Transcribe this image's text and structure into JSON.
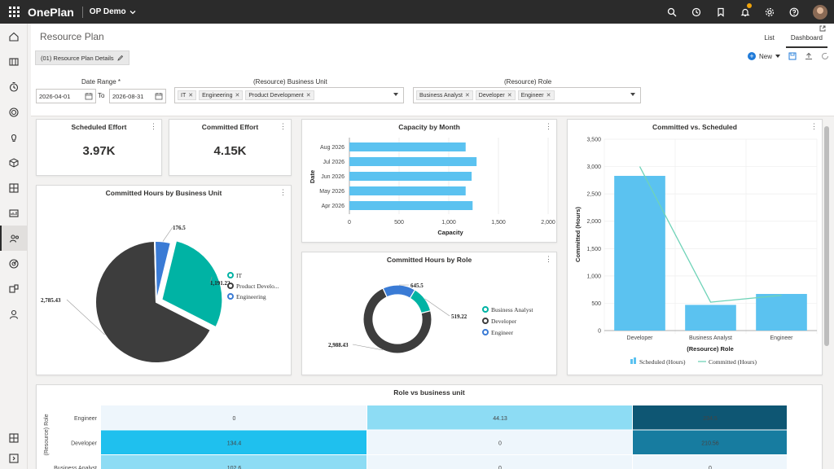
{
  "app": {
    "brand": "OnePlan",
    "environment": "OP Demo"
  },
  "header": {
    "title": "Resource Plan",
    "tabs": [
      "List",
      "Dashboard"
    ]
  },
  "cmdbar": {
    "chip_label": "(01) Resource Plan Details",
    "new_label": "New"
  },
  "filters": {
    "date_range_label": "Date Range *",
    "date_from": "2026-04-01",
    "to_label": "To",
    "date_to": "2026-08-31",
    "business_unit_label": "(Resource) Business Unit",
    "business_unit_tags": [
      "IT",
      "Engineering",
      "Product Development"
    ],
    "role_label": "(Resource) Role",
    "role_tags": [
      "Business Analyst",
      "Developer",
      "Engineer"
    ]
  },
  "kpis": {
    "scheduled": {
      "title": "Scheduled Effort",
      "value": "3.97K"
    },
    "committed": {
      "title": "Committed Effort",
      "value": "4.15K"
    }
  },
  "colors": {
    "teal": "#00b3a4",
    "dark": "#3d3d3d",
    "blue": "#3a7bd5",
    "lightblue": "#5bc2f0",
    "line": "#6fd3b8"
  },
  "chart_data": [
    {
      "type": "pie",
      "title": "Committed Hours by Business Unit",
      "categories": [
        "IT",
        "Product Develo...",
        "Engineering"
      ],
      "values": [
        1191.22,
        2785.43,
        176.5
      ],
      "data_labels": [
        "1,191.22",
        "2,785.43",
        "176.5"
      ],
      "legend_position": "right"
    },
    {
      "type": "bar",
      "orientation": "horizontal",
      "title": "Capacity by Month",
      "categories": [
        "Aug 2026",
        "Jul 2026",
        "Jun 2026",
        "May 2026",
        "Apr 2026"
      ],
      "values": [
        1170,
        1280,
        1230,
        1170,
        1240
      ],
      "xlabel": "Capacity",
      "ylabel": "Date",
      "xlim": [
        0,
        2000
      ],
      "xticks": [
        "0",
        "500",
        "1,000",
        "1,500",
        "2,000"
      ]
    },
    {
      "type": "pie",
      "variant": "donut",
      "title": "Committed Hours by Role",
      "categories": [
        "Business Analyst",
        "Developer",
        "Engineer"
      ],
      "values": [
        519.22,
        2988.43,
        645.5
      ],
      "data_labels": [
        "519.22",
        "2,988.43",
        "645.5"
      ],
      "legend_position": "right"
    },
    {
      "type": "bar",
      "title": "Committed vs. Scheduled",
      "categories": [
        "Developer",
        "Business Analyst",
        "Engineer"
      ],
      "series": [
        {
          "name": "Scheduled (Hours)",
          "type": "bar",
          "values": [
            2830,
            470,
            670
          ]
        },
        {
          "name": "Committed (Hours)",
          "type": "line",
          "values": [
            3000,
            520,
            645
          ]
        }
      ],
      "xlabel": "(Resource) Role",
      "ylabel": "Committed (Hours)",
      "ylim": [
        0,
        3500
      ],
      "yticks": [
        "0",
        "500",
        "1,000",
        "1,500",
        "2,000",
        "2,500",
        "3,000",
        "3,500"
      ]
    },
    {
      "type": "heatmap",
      "title": "Role vs business unit",
      "ylabel": "(Resource) Role",
      "rows": [
        "Engineer",
        "Developer",
        "Business Analyst"
      ],
      "cells": [
        [
          0,
          44.13,
          234.5
        ],
        [
          134.4,
          0,
          210.56
        ],
        [
          102.6,
          0,
          0
        ]
      ],
      "cell_labels": [
        [
          "0",
          "44.13",
          "234.5"
        ],
        [
          "134.4",
          "0",
          "210.56"
        ],
        [
          "102.6",
          "0",
          "0"
        ]
      ]
    }
  ]
}
